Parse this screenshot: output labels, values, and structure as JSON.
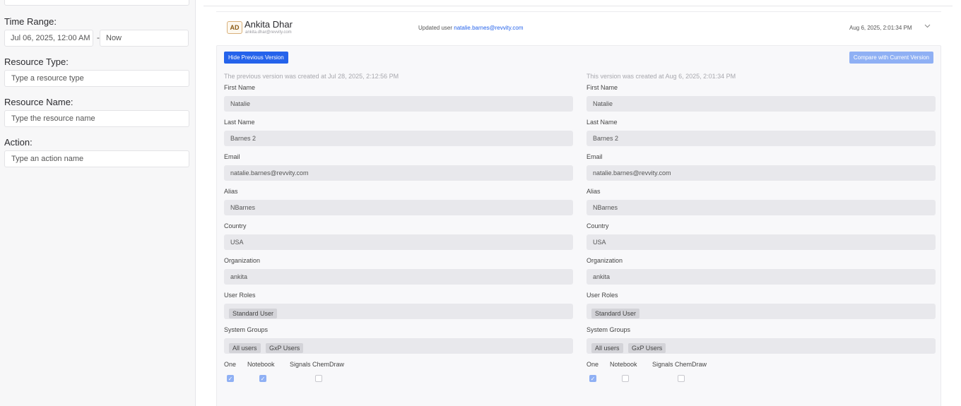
{
  "sidebar": {
    "time_range": {
      "label": "Time Range:",
      "start": "Jul 06, 2025, 12:00 AM",
      "separator": "-",
      "end": "Now"
    },
    "resource_type": {
      "label": "Resource Type:",
      "placeholder": "Type a resource type"
    },
    "resource_name": {
      "label": "Resource Name:",
      "placeholder": "Type the resource name"
    },
    "action": {
      "label": "Action:",
      "placeholder": "Type an action name"
    }
  },
  "entry": {
    "avatar_initials": "AD",
    "user_name": "Ankita Dhar",
    "user_email": "ankita.dhar@revvity.com",
    "action_prefix": "Updated user",
    "action_target": "natalie.barnes@revvity.com",
    "timestamp": "Aug 6, 2025, 2:01:34 PM",
    "expand_icon": "chevron-down-icon"
  },
  "detail": {
    "hide_button": "Hide Previous Version",
    "compare_button": "Compare with Current Version",
    "previous": {
      "created_note": "The previous version was created at Jul 28, 2025, 2:12:56 PM",
      "fields": [
        {
          "label": "First Name",
          "value": "Natalie"
        },
        {
          "label": "Last Name",
          "value": "Barnes 2"
        },
        {
          "label": "Email",
          "value": "natalie.barnes@revvity.com"
        },
        {
          "label": "Alias",
          "value": "NBarnes"
        },
        {
          "label": "Country",
          "value": "USA"
        },
        {
          "label": "Organization",
          "value": "ankita"
        }
      ],
      "user_roles_label": "User Roles",
      "user_roles": [
        "Standard User"
      ],
      "system_groups_label": "System Groups",
      "system_groups": [
        "All users",
        "GxP Users"
      ],
      "apps": [
        {
          "label": "One",
          "checked": true
        },
        {
          "label": "Notebook",
          "checked": true
        },
        {
          "label": "Signals ChemDraw",
          "checked": false
        }
      ]
    },
    "current": {
      "created_note": "This version was created at Aug 6, 2025, 2:01:34 PM",
      "fields": [
        {
          "label": "First Name",
          "value": "Natalie"
        },
        {
          "label": "Last Name",
          "value": "Barnes 2"
        },
        {
          "label": "Email",
          "value": "natalie.barnes@revvity.com"
        },
        {
          "label": "Alias",
          "value": "NBarnes"
        },
        {
          "label": "Country",
          "value": "USA"
        },
        {
          "label": "Organization",
          "value": "ankita"
        }
      ],
      "user_roles_label": "User Roles",
      "user_roles": [
        "Standard User"
      ],
      "system_groups_label": "System Groups",
      "system_groups": [
        "All users",
        "GxP Users"
      ],
      "apps": [
        {
          "label": "One",
          "checked": true
        },
        {
          "label": "Notebook",
          "checked": false
        },
        {
          "label": "Signals ChemDraw",
          "checked": false
        }
      ]
    }
  }
}
